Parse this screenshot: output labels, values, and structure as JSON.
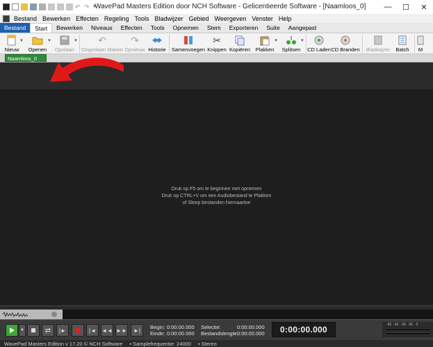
{
  "window": {
    "title": "WavePad Masters Edition door NCH Software - Gelicentieerde Software - [Naamloos_0]",
    "controls": [
      "minimize-icon",
      "maximize-icon",
      "close-icon"
    ]
  },
  "menubar": {
    "items": [
      "Bestand",
      "Bewerken",
      "Effecten",
      "Regeling",
      "Tools",
      "Bladwijzer",
      "Gebied",
      "Weergeven",
      "Venster",
      "Help"
    ]
  },
  "tabs": {
    "items": [
      "Bestand",
      "Start",
      "Bewerken",
      "Niveaus",
      "Effecten",
      "Tools",
      "Opnemen",
      "Stem",
      "Exporteren",
      "Suite",
      "Aangepast"
    ],
    "active": "Start"
  },
  "ribbon": {
    "buttons": [
      {
        "label": "Nieuw",
        "icon": "new-file-icon",
        "dropdown": true,
        "disabled": false
      },
      {
        "label": "Openen",
        "icon": "open-folder-icon",
        "dropdown": true,
        "disabled": false
      },
      {
        "label": "Opslaan",
        "icon": "save-disk-icon",
        "dropdown": true,
        "disabled": true
      },
      {
        "label": "Ongedaan Maken",
        "icon": "undo-icon",
        "dropdown": false,
        "disabled": true
      },
      {
        "label": "Opnieuw",
        "icon": "redo-icon",
        "dropdown": false,
        "disabled": true
      },
      {
        "label": "Historie",
        "icon": "history-icon",
        "dropdown": false,
        "disabled": false
      },
      {
        "label": "Samenvoegen",
        "icon": "merge-icon",
        "dropdown": false,
        "disabled": false
      },
      {
        "label": "Knippen",
        "icon": "scissors-icon",
        "dropdown": false,
        "disabled": false
      },
      {
        "label": "Kopiëren",
        "icon": "copy-icon",
        "dropdown": false,
        "disabled": false
      },
      {
        "label": "Plakken",
        "icon": "paste-icon",
        "dropdown": true,
        "disabled": false
      },
      {
        "label": "Splitsen",
        "icon": "split-icon",
        "dropdown": true,
        "disabled": false
      },
      {
        "label": "CD Laden",
        "icon": "cd-load-icon",
        "dropdown": false,
        "disabled": false
      },
      {
        "label": "CD Branden",
        "icon": "cd-burn-icon",
        "dropdown": false,
        "disabled": false
      },
      {
        "label": "Bladwijzer",
        "icon": "bookmark-icon",
        "dropdown": false,
        "disabled": true
      },
      {
        "label": "Batch",
        "icon": "batch-icon",
        "dropdown": false,
        "disabled": false
      },
      {
        "label": "M",
        "icon": "more-icon",
        "dropdown": false,
        "disabled": false
      }
    ]
  },
  "document": {
    "tab_label": "Naamloos_0"
  },
  "waveform": {
    "hint_lines": [
      "Druk op F5 om te beginnen met opnemen",
      "Druk op CTRL+V om een Audiobestand te Plakken",
      "of Sleep bestanden hiernaartoe"
    ]
  },
  "transport": {
    "begin_label": "Begin:",
    "begin_value": "0:00:00.000",
    "end_label": "Einde:",
    "end_value": "0:00:00.000",
    "selection_label": "Selectie:",
    "selection_value": "0:00:00.000",
    "length_label": "Bestandslengte:",
    "length_value": "0:00:00.000",
    "time_display": "0:00:00.000",
    "meter_scale": [
      "-45",
      "-42",
      "-39",
      "-36",
      "-3"
    ]
  },
  "status": {
    "version": "WavePad Masters Edition v 17.20 © NCH Software",
    "samplerate": "Samplefrequentie: 24000",
    "channels": "Stereo"
  },
  "colors": {
    "file_tab": "#1f5fae",
    "document_tab": "#2f8a3a",
    "arrow": "#e01818",
    "play": "#3aa832",
    "record": "#e02020"
  }
}
